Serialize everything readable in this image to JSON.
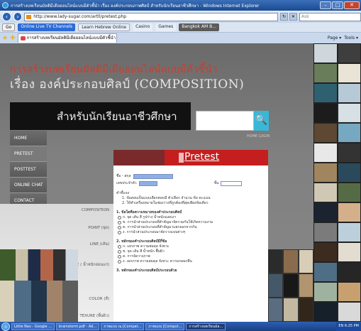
{
  "window": {
    "title": "การสร้างบทเรียนมัลติมีเดียออนไลน์แบบมีตัวชี้นำ เรื่อง องค์ประกอบภาพศิลป์ สำหรับนักเรียนอาชีวศึกษา - Windows Internet Explorer",
    "minimize": "–",
    "maximize": "□",
    "close": "✕"
  },
  "address": {
    "url": "http://www.lady-sugar.com/artll/pretest.php",
    "search_placeholder": "Ask"
  },
  "links": {
    "go": "Go",
    "live_tv": "Online Live TV Channels",
    "hebrew": "Learn Hebrew Online",
    "casino": "Casino",
    "games": "Games",
    "user": "Bangkok AM B..."
  },
  "tabs": {
    "active_tab": "การสร้างบทเรียนมัลติมีเดียออนไลน์แบบมีตัวชี้นำ เรื่อง องค์ประกอบ...",
    "commands": [
      "Page ▾",
      "Tools ▾"
    ]
  },
  "site": {
    "title_line1": "การสร้างบทเรียนมัลติมีเดียออนไลน์แบบมีตัวชี้นำ",
    "title_line2": "เรื่อง องค์ประกอบศิลป์ (COMPOSITION)",
    "banner": "สำหรับนักเรียนอาชีวศึกษา",
    "search_button": "🔍",
    "top_links": "HOME   LOGIN",
    "menu": [
      "HOME",
      "PRETEST",
      "POSTTEST",
      "ONLINE CHAT",
      "CONTACT"
    ],
    "section": "Pretest"
  },
  "form": {
    "name_label": "ชื่อ - สกุล",
    "id_label": "เลขประจำตัว",
    "class_label": "ชั้น",
    "instructions_title": "คำชี้แจง",
    "instruction_1": "1. ข้อสอบเป็นแบบเลือกตอบมี  ตัวเลือก จำนวน   ข้อ   คะแนน",
    "instruction_2": "2. ให้ทำเครื่องหมายในช่องว่างที่ถูกต้องที่สุดเพียงข้อเดียว"
  },
  "questions": [
    {
      "text": "1. ข้อใดคือความหมายของคำประกอบศิลป์",
      "options": [
        "ก. จุด เส้น สี รูปร่าง น้ำหนักแสงเงา",
        "ข. การนำส่วนประกอบที่สำคัญมาจัดรวมกันให้เกิดความงาม",
        "ค. การนำส่วนประกอบที่สำคัญมาแยกออกจากกัน",
        "ง. การนำส่วนประกอบมาจัดวางแบบต่างๆ"
      ]
    },
    {
      "text": "2. หลักของคำประกอบศิลป์มีกี่ข้อ",
      "options": [
        "ก. เอกภาพ ความสมดุล จังหวะ",
        "ข. จุด เส้น สี น้ำหนัก พื้นผิว",
        "ค. การจัดวางภาพ",
        "ง. เอกภาพ ความสมดุล จังหวะ ความกลมกลืน"
      ]
    },
    {
      "text": "3. หลักของคำประกอบศิลป์ประกอบด้วย",
      "options": []
    }
  ],
  "side_labels": [
    "COMPOSITION",
    "POINT (จุด)",
    "LINE (เส้น)",
    "TONE ( น้ำหนักอ่อนแก่)",
    "COLOR (สี)",
    "TEXURE (พื้นผิว)"
  ],
  "taskbar": {
    "items": [
      "Little Nav - Google ...",
      "brainstorm.pdf - Ad...",
      "ภาพแบบ ณ [Compat...",
      "ภาพแบบ [Comput...",
      "การสร้างบทเรียนมัล..."
    ],
    "clock": "6:25 PM",
    "lang": "EN"
  },
  "colors": {
    "accent_red": "#c41e1e",
    "search_cyan": "#39b7d7",
    "title_red": "#d43a2a"
  }
}
